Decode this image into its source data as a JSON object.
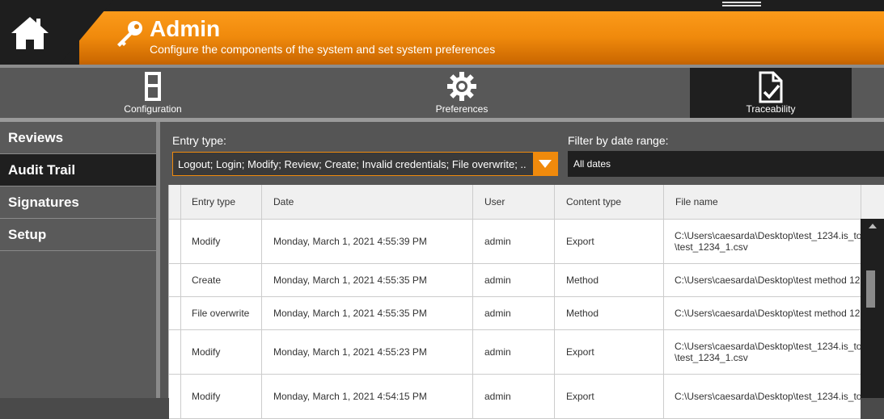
{
  "header": {
    "title": "Admin",
    "subtitle": "Configure the components of the system and set system preferences"
  },
  "tabs": [
    {
      "label": "Configuration",
      "icon": "ladder-icon",
      "active": false
    },
    {
      "label": "Preferences",
      "icon": "gear-icon",
      "active": false
    },
    {
      "label": "Traceability",
      "icon": "document-check-icon",
      "active": true
    }
  ],
  "sidebar": {
    "items": [
      {
        "label": "Reviews",
        "active": false
      },
      {
        "label": "Audit Trail",
        "active": true
      },
      {
        "label": "Signatures",
        "active": false
      },
      {
        "label": "Setup",
        "active": false
      }
    ]
  },
  "filters": {
    "entry_type_label": "Entry type:",
    "entry_type_value": "Logout; Login; Modify; Review; Create; Invalid credentials; File overwrite; ...",
    "date_range_label": "Filter by date range:",
    "date_range_value": "All dates"
  },
  "table": {
    "columns": [
      "Entry type",
      "Date",
      "User",
      "Content type",
      "File name"
    ],
    "rows": [
      {
        "entry_type": "Modify",
        "date": "Monday, March 1, 2021 4:55:39 PM",
        "user": "admin",
        "content_type": "Export",
        "file_name": "C:\\Users\\caesarda\\Desktop\\test_1234.is_to\n\\test_1234_1.csv"
      },
      {
        "entry_type": "Create",
        "date": "Monday, March 1, 2021 4:55:35 PM",
        "user": "admin",
        "content_type": "Method",
        "file_name": "C:\\Users\\caesarda\\Desktop\\test method 12"
      },
      {
        "entry_type": "File overwrite",
        "date": "Monday, March 1, 2021 4:55:35 PM",
        "user": "admin",
        "content_type": "Method",
        "file_name": "C:\\Users\\caesarda\\Desktop\\test method 12"
      },
      {
        "entry_type": "Modify",
        "date": "Monday, March 1, 2021 4:55:23 PM",
        "user": "admin",
        "content_type": "Export",
        "file_name": "C:\\Users\\caesarda\\Desktop\\test_1234.is_to\n\\test_1234_1.csv"
      },
      {
        "entry_type": "Modify",
        "date": "Monday, March 1, 2021 4:54:15 PM",
        "user": "admin",
        "content_type": "Export",
        "file_name": "C:\\Users\\caesarda\\Desktop\\test_1234.is_to"
      }
    ]
  },
  "colors": {
    "accent": "#f08a0c",
    "dark": "#1f1f1f"
  }
}
